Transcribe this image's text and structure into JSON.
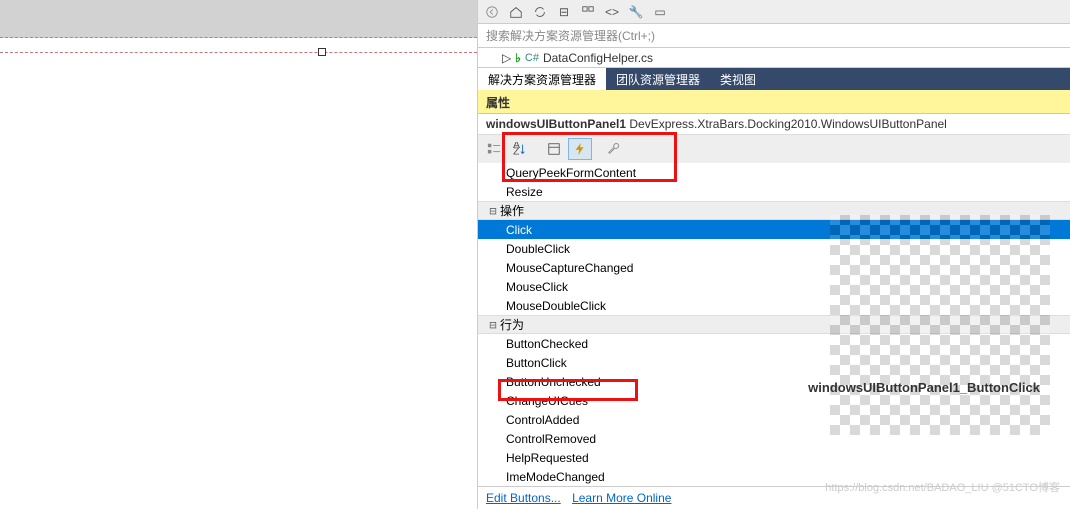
{
  "toolbar": {
    "search_placeholder": "搜索解决方案资源管理器(Ctrl+;)"
  },
  "tree": {
    "file_icon": "C#",
    "filename": "DataConfigHelper.cs"
  },
  "tabs": {
    "active": "解决方案资源管理器",
    "items": [
      "解决方案资源管理器",
      "团队资源管理器",
      "类视图"
    ]
  },
  "properties": {
    "header": "属性",
    "object_name": "windowsUIButtonPanel1",
    "object_type": "DevExpress.XtraBars.Docking2010.WindowsUIButtonPanel"
  },
  "events": {
    "misc": [
      "QueryPeekFormContent",
      "Resize"
    ],
    "category_action": "操作",
    "action_items": [
      "Click",
      "DoubleClick",
      "MouseCaptureChanged",
      "MouseClick",
      "MouseDoubleClick"
    ],
    "category_behavior": "行为",
    "behavior_items": [
      "ButtonChecked",
      "ButtonClick",
      "ButtonUnchecked",
      "ChangeUICues",
      "ControlAdded",
      "ControlRemoved",
      "HelpRequested",
      "ImeModeChanged"
    ],
    "selected": "Click"
  },
  "qr_label": "windowsUIButtonPanel1_ButtonClick",
  "links": {
    "edit": "Edit Buttons...",
    "learn": "Learn More Online"
  },
  "watermark": "https://blog.csdn.net/BADAO_LIU @51CTO博客"
}
